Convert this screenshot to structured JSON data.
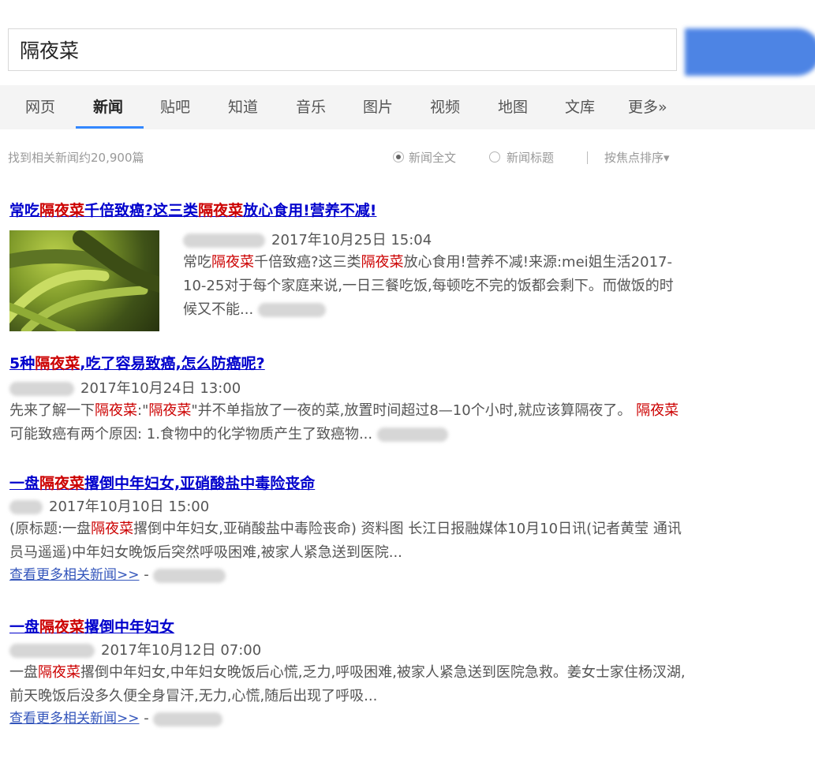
{
  "search": {
    "query": "隔夜菜",
    "button_label": ""
  },
  "nav": {
    "tabs": [
      "网页",
      "新闻",
      "贴吧",
      "知道",
      "音乐",
      "图片",
      "视频",
      "地图",
      "文库",
      "更多»"
    ],
    "active": 1
  },
  "meta": {
    "result_count": "找到相关新闻约20,900篇",
    "filter_full": "新闻全文",
    "filter_title": "新闻标题",
    "divider": "|",
    "sort_label": "按焦点排序▾"
  },
  "results": [
    {
      "title_parts": [
        "常吃",
        "隔夜菜",
        "千倍致癌?这三类",
        "隔夜菜",
        "放心食用!营养不减!"
      ],
      "date": "2017年10月25日 15:04",
      "abstract_parts": [
        "常吃",
        "隔夜菜",
        "千倍致癌?这三类",
        "隔夜菜",
        "放心食用!营养不减!来源:mei姐生活2017-10-25对于每个家庭来说,一日三餐吃饭,每顿吃不完的饭都会剩下。而做饭的时候又不能..."
      ]
    },
    {
      "title_parts": [
        "5种",
        "隔夜菜",
        ",吃了容易致癌,怎么防癌呢?"
      ],
      "date": "2017年10月24日 13:00",
      "abstract_parts": [
        "先来了解一下",
        "隔夜菜",
        ":\"",
        "隔夜菜",
        "\"并不单指放了一夜的菜,放置时间超过8—10个小时,就应该算隔夜了。 ",
        "隔夜菜",
        "可能致癌有两个原因: 1.食物中的化学物质产生了致癌物..."
      ]
    },
    {
      "title_parts": [
        "一盘",
        "隔夜菜",
        "撂倒中年妇女,亚硝酸盐中毒险丧命"
      ],
      "date": "2017年10月10日 15:00",
      "abstract_parts": [
        "(原标题:一盘",
        "隔夜菜",
        "撂倒中年妇女,亚硝酸盐中毒险丧命) 资料图 长江日报融媒体10月10日讯(记者黄莹 通讯员马遥遥)中年妇女晚饭后突然呼吸困难,被家人紧急送到医院..."
      ],
      "more_link": "查看更多相关新闻>>",
      "more_sep": " - "
    },
    {
      "title_parts": [
        "一盘",
        "隔夜菜",
        "撂倒中年妇女"
      ],
      "date": "2017年10月12日 07:00",
      "abstract_parts": [
        "一盘",
        "隔夜菜",
        "撂倒中年妇女,中年妇女晚饭后心慌,乏力,呼吸困难,被家人紧急送到医院急救。姜女士家住杨汊湖,前天晚饭后没多久便全身冒汗,无力,心慌,随后出现了呼吸..."
      ],
      "more_link": "查看更多相关新闻>>",
      "more_sep": " - "
    }
  ]
}
